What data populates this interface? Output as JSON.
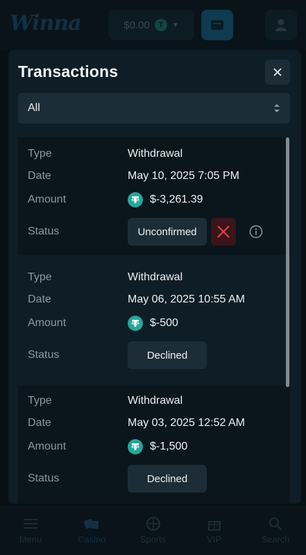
{
  "header": {
    "logo": "Winna",
    "balance": "$0.00",
    "coin_symbol": "T"
  },
  "modal": {
    "title": "Transactions",
    "filter": {
      "selected": "All"
    }
  },
  "labels": {
    "type": "Type",
    "date": "Date",
    "amount": "Amount",
    "status": "Status"
  },
  "transactions": [
    {
      "type": "Withdrawal",
      "date": "May 10, 2025 7:05 PM",
      "amount": "$-3,261.39",
      "status": "Unconfirmed"
    },
    {
      "type": "Withdrawal",
      "date": "May 06, 2025 10:55 AM",
      "amount": "$-500",
      "status": "Declined"
    },
    {
      "type": "Withdrawal",
      "date": "May 03, 2025 12:52 AM",
      "amount": "$-1,500",
      "status": "Declined"
    }
  ],
  "nav": {
    "items": [
      {
        "label": "Menu",
        "icon": "menu-icon"
      },
      {
        "label": "Casino",
        "icon": "dice-icon"
      },
      {
        "label": "Sports",
        "icon": "basketball-icon"
      },
      {
        "label": "VIP",
        "icon": "gift-icon"
      },
      {
        "label": "Search",
        "icon": "search-icon"
      }
    ]
  },
  "colors": {
    "background": "#0d1a22",
    "modal": "#0f1d26",
    "card_dark": "#0a151c",
    "badge": "#1d2d37",
    "tether": "#26a69a",
    "cancel": "#e0454f"
  }
}
